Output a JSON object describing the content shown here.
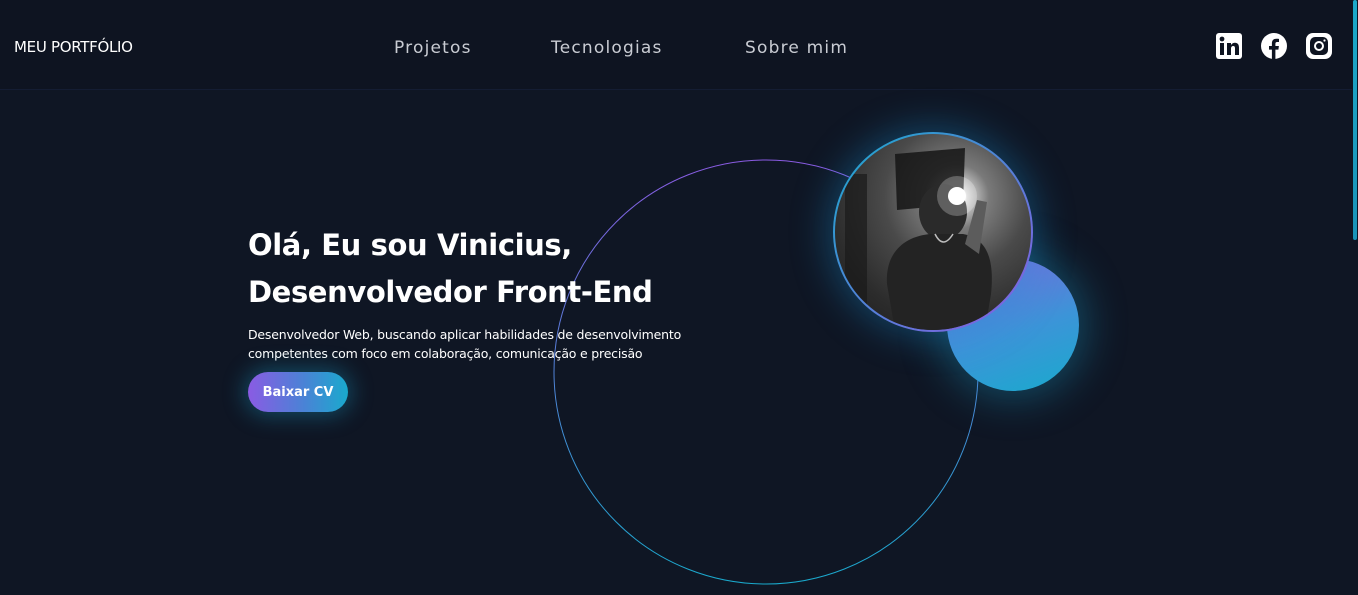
{
  "navbar": {
    "brand": "MEU PORTFÓLIO",
    "links": [
      {
        "label": "Projetos"
      },
      {
        "label": "Tecnologias"
      },
      {
        "label": "Sobre mim"
      }
    ],
    "social": [
      {
        "icon": "linkedin-icon"
      },
      {
        "icon": "facebook-icon"
      },
      {
        "icon": "instagram-icon"
      }
    ]
  },
  "hero": {
    "title_line1": "Olá, Eu sou Vinicius,",
    "title_line2": "Desenvolvedor Front-End",
    "description_line1": "Desenvolvedor Web, buscando aplicar habilidades de desenvolvimento",
    "description_line2": "competentes com foco em colaboração, comunicação e precisão",
    "cta_label": "Baixar CV"
  },
  "theme": {
    "background": "#0f1624",
    "gradient_start": "#8a5be3",
    "gradient_end": "#19aacd",
    "text": "#ffffff"
  }
}
